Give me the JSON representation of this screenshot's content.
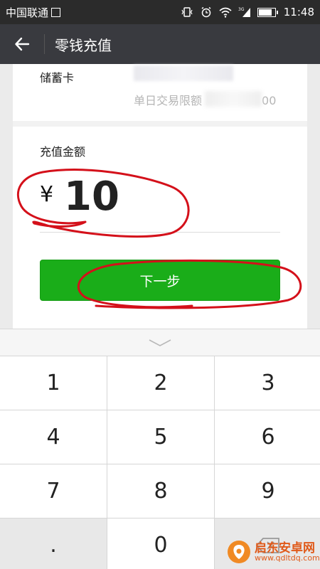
{
  "status_bar": {
    "carrier": "中国联通",
    "time": "11:48",
    "network": "3G",
    "battery_level": 0.85
  },
  "header": {
    "title": "零钱充值",
    "back_icon": "arrow-left-icon"
  },
  "bank": {
    "name": "储蓄卡",
    "limit_label": "单日交易限额",
    "limit_suffix": "00"
  },
  "amount": {
    "label": "充值金额",
    "currency": "¥",
    "value": "10"
  },
  "next_button": {
    "label": "下一步"
  },
  "keypad": {
    "keys": [
      "1",
      "2",
      "3",
      "4",
      "5",
      "6",
      "7",
      "8",
      "9",
      ".",
      "0",
      ""
    ]
  },
  "watermark": {
    "title": "启东安卓网",
    "url": "www.qdltdq.com"
  },
  "colors": {
    "primary_green": "#1aad19",
    "title_bar": "#393a3f",
    "status_bar": "#2b2b2b",
    "annotation_red": "#d4101a"
  }
}
